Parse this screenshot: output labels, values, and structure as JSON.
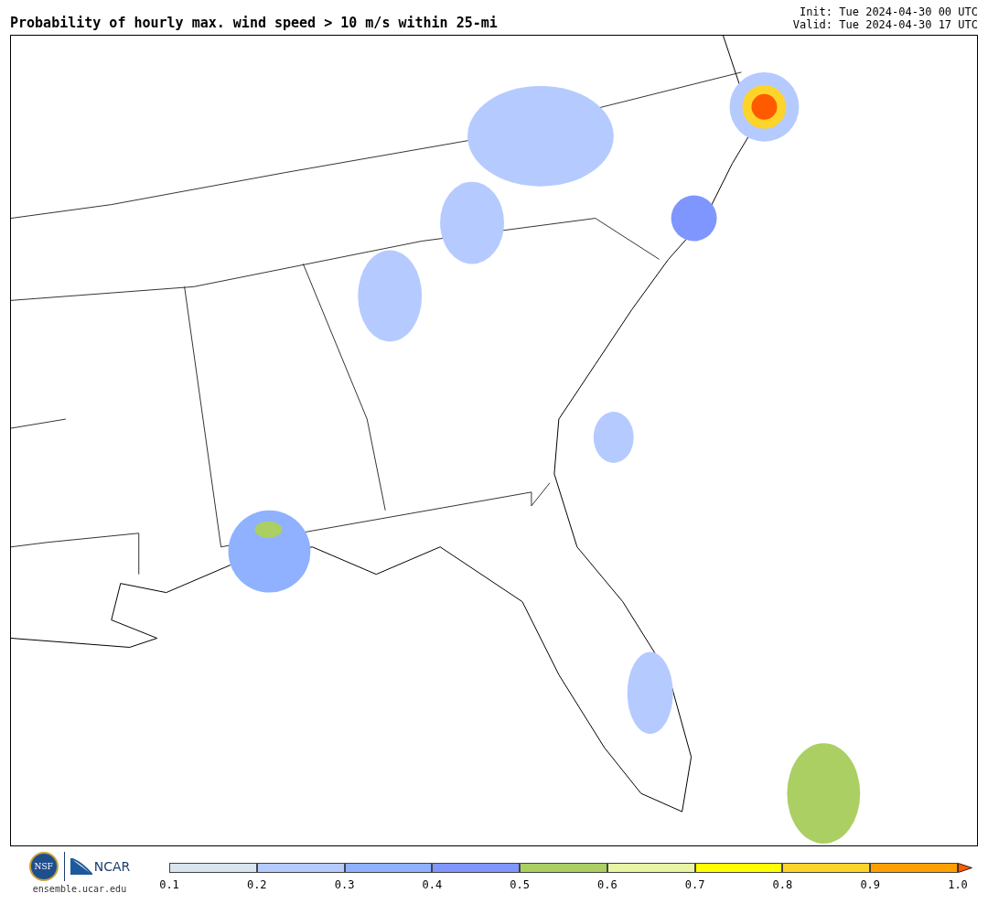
{
  "title": "Probability of hourly max. wind speed > 10 m/s within 25-mi",
  "init": "Init: Tue 2024-04-30 00 UTC",
  "valid": "Valid: Tue 2024-04-30 17 UTC",
  "logos": {
    "nsf": "NSF",
    "ncar": "NCAR",
    "site": "ensemble.ucar.edu"
  },
  "colorbar": {
    "bins": [
      {
        "kind": "segment",
        "color": "#d8e4ee"
      },
      {
        "kind": "segment",
        "color": "#b5caff"
      },
      {
        "kind": "segment",
        "color": "#8fb1ff"
      },
      {
        "kind": "segment",
        "color": "#7f96ff"
      },
      {
        "kind": "segment",
        "color": "#abcf63"
      },
      {
        "kind": "segment",
        "color": "#e8f5a4"
      },
      {
        "kind": "segment",
        "color": "#ffff00"
      },
      {
        "kind": "segment",
        "color": "#ffd42a"
      },
      {
        "kind": "segment",
        "color": "#ff9f00"
      },
      {
        "kind": "arrow",
        "color": "#ff5a00"
      }
    ],
    "ticks": [
      "0.1",
      "0.2",
      "0.3",
      "0.4",
      "0.5",
      "0.6",
      "0.7",
      "0.8",
      "0.9",
      "1.0"
    ]
  }
}
